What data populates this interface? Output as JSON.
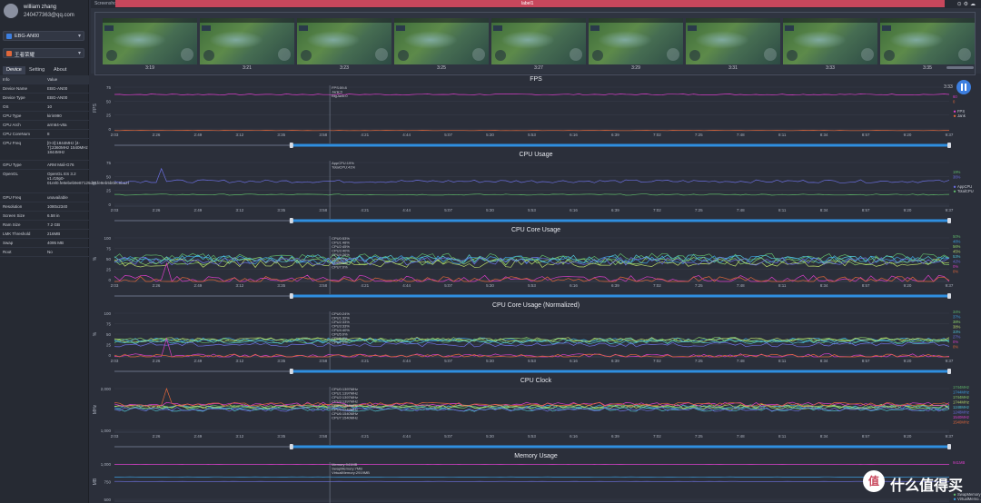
{
  "user": {
    "name": "william zhang",
    "email": "240477363@qq.com"
  },
  "device_select": {
    "label": "EBG-AN00"
  },
  "app_select": {
    "label": "王者荣耀"
  },
  "tabs": [
    "Device",
    "Setting",
    "About"
  ],
  "info": {
    "headers": [
      "Info",
      "Value"
    ],
    "rows": [
      [
        "Device Name",
        "EBG-AN00"
      ],
      [
        "Device Type",
        "EBG-AN00"
      ],
      [
        "OS",
        "10"
      ],
      [
        "CPU Type",
        "kirin990"
      ],
      [
        "CPU Arch",
        "arm64-v8a"
      ],
      [
        "CPU CoreNum",
        "8"
      ],
      [
        "CPU Freq",
        "[0-3]:1844MHz\n[4-7]:2360MHz\n1540MHz\n1844MHz"
      ],
      [
        "GPU Type",
        "ARM Mali-G76"
      ],
      [
        "OpenGL",
        "OpenGL ES 3.2 v1.r19p0-01rel0.fe8ebeb9e87125d81fe9eb5b0ec9ba2f"
      ],
      [
        "GPU Freq",
        "unavailable"
      ],
      [
        "Resolution",
        "1080x2340"
      ],
      [
        "Screen Size",
        "6.58 in"
      ],
      [
        "Ram Size",
        "7.2 GB"
      ],
      [
        "LMK Threshold",
        "216MB"
      ],
      [
        "Swap",
        "4095 MB"
      ],
      [
        "Root",
        "No"
      ]
    ]
  },
  "topbar": {
    "left_label": "Screenshot",
    "center_label": "label1",
    "icons": [
      "record-icon",
      "settings-icon",
      "cloud-icon"
    ]
  },
  "filmstrip": {
    "times": [
      "3:19",
      "3:21",
      "3:23",
      "3:25",
      "3:27",
      "3:29",
      "3:31",
      "3:33",
      "3:35"
    ]
  },
  "time_readout": "3:33",
  "x_ticks": [
    "2:03",
    "2:26",
    "2:49",
    "3:12",
    "3:35",
    "3:58",
    "4:21",
    "4:44",
    "5:07",
    "5:30",
    "5:53",
    "6:16",
    "6:39",
    "7:02",
    "7:25",
    "7:48",
    "8:11",
    "8:34",
    "8:57",
    "9:20",
    "9:37"
  ],
  "colors": {
    "fps": "#d83ec8",
    "jank": "#e0673a",
    "appcpu": "#6b6fe0",
    "totalcpu": "#5fb86a",
    "bar": "#2f8fe0",
    "bg": "#2b2f3a"
  },
  "chart_data": [
    {
      "type": "line",
      "title": "FPS",
      "ylabel": "FPS",
      "yticks": [
        "75",
        "50",
        "25",
        "0"
      ],
      "ylim": [
        0,
        75
      ],
      "series": [
        {
          "name": "FPS",
          "color": "#d83ec8",
          "value": 60
        },
        {
          "name": "Jank",
          "color": "#e0673a",
          "value": 0
        }
      ],
      "tooltip": [
        "FPS:59.8",
        "Jank:0",
        "BigJank:0"
      ],
      "right_values": [
        "60",
        "0"
      ]
    },
    {
      "type": "line",
      "title": "CPU Usage",
      "ylabel": "%",
      "yticks": [
        "75",
        "50",
        "25",
        "0"
      ],
      "ylim": [
        0,
        75
      ],
      "series": [
        {
          "name": "AppCPU",
          "color": "#6b6fe0",
          "value": 41
        },
        {
          "name": "TotalCPU",
          "color": "#5fb86a",
          "value": 19
        }
      ],
      "tooltip": [
        "AppCPU:19%",
        "TotalCPU:41%"
      ],
      "right_values": [
        "19%",
        "36%"
      ]
    },
    {
      "type": "line",
      "title": "CPU Core Usage",
      "ylabel": "%",
      "yticks": [
        "100",
        "75",
        "50",
        "25",
        "0"
      ],
      "ylim": [
        0,
        100
      ],
      "tooltip": [
        "CPU0:53%",
        "CPU1:48%",
        "CPU2:45%",
        "CPU3:40%",
        "CPU4:26%",
        "CPU5:0%",
        "CPU6:2%",
        "CPU7:0%"
      ],
      "right_values": [
        "50%",
        "48%",
        "56%",
        "45%",
        "53%",
        "42%",
        "0%",
        "0%"
      ]
    },
    {
      "type": "line",
      "title": "CPU Core Usage (Normalized)",
      "ylabel": "%",
      "yticks": [
        "100",
        "75",
        "50",
        "25",
        "0"
      ],
      "ylim": [
        0,
        100
      ],
      "tooltip": [
        "CPU0:24%",
        "CPU1:32%",
        "CPU2:33%",
        "CPU3:33%",
        "CPU4:40%",
        "CPU5:0%",
        "CPU6:0%",
        "CPU7:2%"
      ],
      "right_values": [
        "34%",
        "37%",
        "38%",
        "38%",
        "33%",
        "27%",
        "0%",
        "0%"
      ]
    },
    {
      "type": "line",
      "title": "CPU Clock",
      "ylabel": "MHz",
      "yticks": [
        "2,000",
        "1,000"
      ],
      "ylim": [
        0,
        2500
      ],
      "tooltip": [
        "CPU0:1397MHz",
        "CPU1:1397MHz",
        "CPU2:1397MHz",
        "CPU3:1397MHz",
        "CPU4:1248MHz",
        "CPU5:1248MHz",
        "CPU6:1540MHz",
        "CPU7:1540MHz"
      ],
      "right_values": [
        "1744MHz",
        "1744MHz",
        "1744MHz",
        "1744MHz",
        "1248MHz",
        "1248MHz",
        "1540MHz",
        "1540MHz"
      ]
    },
    {
      "type": "line",
      "title": "Memory Usage",
      "ylabel": "MB",
      "yticks": [
        "1,000",
        "750",
        "500"
      ],
      "ylim": [
        0,
        1000
      ],
      "tooltip": [
        "Memory:941MB",
        "SwapMemory:7MB",
        "VirtualMemory:2919MB"
      ],
      "right_values": [
        "941MB"
      ],
      "legend": [
        "SwapMemory",
        "VirtualMemo..."
      ]
    }
  ]
}
